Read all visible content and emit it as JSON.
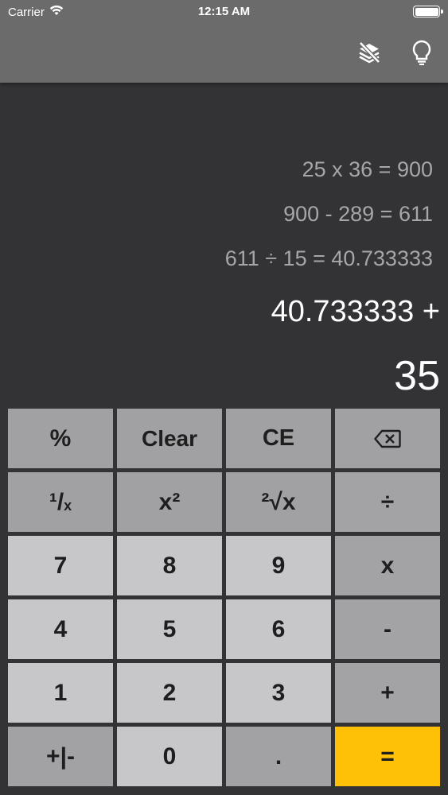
{
  "status_bar": {
    "carrier": "Carrier",
    "time": "12:15 AM"
  },
  "toolbar": {
    "icons": [
      "layers-off-icon",
      "lightbulb-icon"
    ]
  },
  "history": [
    "25 x 36 = 900",
    "900 - 289 = 611",
    "611 ÷ 15 = 40.733333"
  ],
  "expression": "40.733333 +",
  "result": "35",
  "keys": {
    "percent": "%",
    "clear": "Clear",
    "ce": "CE",
    "reciprocal_main": "¹/",
    "reciprocal_sub": "x",
    "square": "x²",
    "sqrt": "²√x",
    "divide": "÷",
    "seven": "7",
    "eight": "8",
    "nine": "9",
    "multiply": "x",
    "four": "4",
    "five": "5",
    "six": "6",
    "minus": "-",
    "one": "1",
    "two": "2",
    "three": "3",
    "plus": "+",
    "sign": "+|-",
    "zero": "0",
    "dot": ".",
    "equals": "="
  },
  "colors": {
    "background": "#333234",
    "header": "#6c6b6c",
    "equals": "#fec107",
    "history_text": "#a7a6a8"
  }
}
